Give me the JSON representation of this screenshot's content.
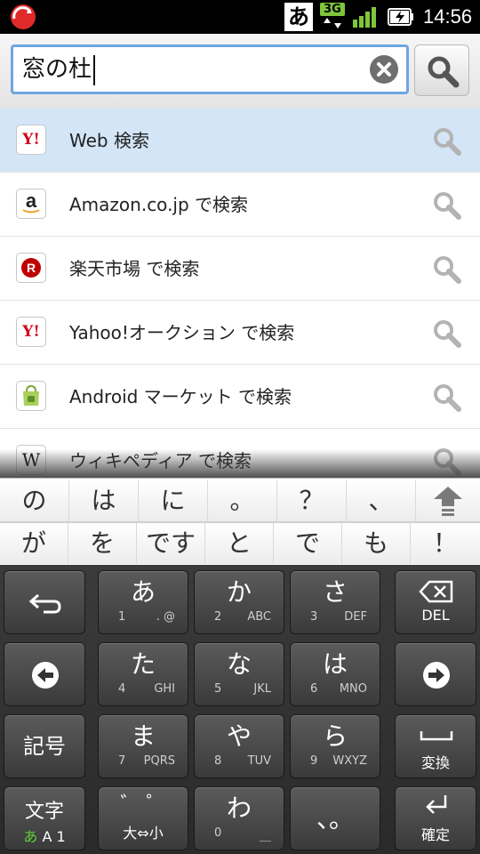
{
  "status_bar": {
    "ime_indicator": "あ",
    "network": "3G",
    "time": "14:56",
    "icons": [
      "app-notification-icon",
      "signal-icon",
      "battery-charging-icon"
    ]
  },
  "search": {
    "query": "窓の杜",
    "clear_icon": "clear-icon",
    "search_icon": "magnifier-icon"
  },
  "suggestions": [
    {
      "label": "Web 検索",
      "icon": "yahoo-icon",
      "icon_text": "Y!"
    },
    {
      "label": "Amazon.co.jp で検索",
      "icon": "amazon-icon",
      "icon_text": "a"
    },
    {
      "label": "楽天市場 で検索",
      "icon": "rakuten-icon",
      "icon_text": "R"
    },
    {
      "label": "Yahoo!オークション で検索",
      "icon": "yahoo-auction-icon",
      "icon_text": "Y!"
    },
    {
      "label": "Android マーケット で検索",
      "icon": "android-market-icon",
      "icon_text": ""
    },
    {
      "label": "ウィキペディア で検索",
      "icon": "wikipedia-icon",
      "icon_text": "W"
    }
  ],
  "predictions": {
    "row1": [
      "の",
      "は",
      "に",
      "。",
      "？",
      "、"
    ],
    "row2": [
      "が",
      "を",
      "です",
      "と",
      "で",
      "も",
      "！"
    ]
  },
  "keyboard": {
    "row1": [
      {
        "main": "あ",
        "sub1": "1",
        "sub2": ". @"
      },
      {
        "main": "か",
        "sub1": "2",
        "sub2": "ABC"
      },
      {
        "main": "さ",
        "sub1": "3",
        "sub2": "DEF"
      }
    ],
    "row2": [
      {
        "main": "た",
        "sub1": "4",
        "sub2": "GHI"
      },
      {
        "main": "な",
        "sub1": "5",
        "sub2": "JKL"
      },
      {
        "main": "は",
        "sub1": "6",
        "sub2": "MNO"
      }
    ],
    "row3": [
      {
        "main": "ま",
        "sub1": "7",
        "sub2": "PQRS"
      },
      {
        "main": "や",
        "sub1": "8",
        "sub2": "TUV"
      },
      {
        "main": "ら",
        "sub1": "9",
        "sub2": "WXYZ"
      }
    ],
    "row4": [
      {
        "main": "゛ ゜",
        "sub1": "大⇔小",
        "sub2": ""
      },
      {
        "main": "わ",
        "sub1": "0",
        "sub2": "＿"
      },
      {
        "main": "、。",
        "sub1": "",
        "sub2": ""
      }
    ],
    "del_label": "DEL",
    "symbol_label": "記号",
    "convert_label": "変換",
    "mode_label": "文字",
    "mode_options_active": "あ",
    "mode_options_rest": "A 1",
    "enter_label": "確定"
  }
}
